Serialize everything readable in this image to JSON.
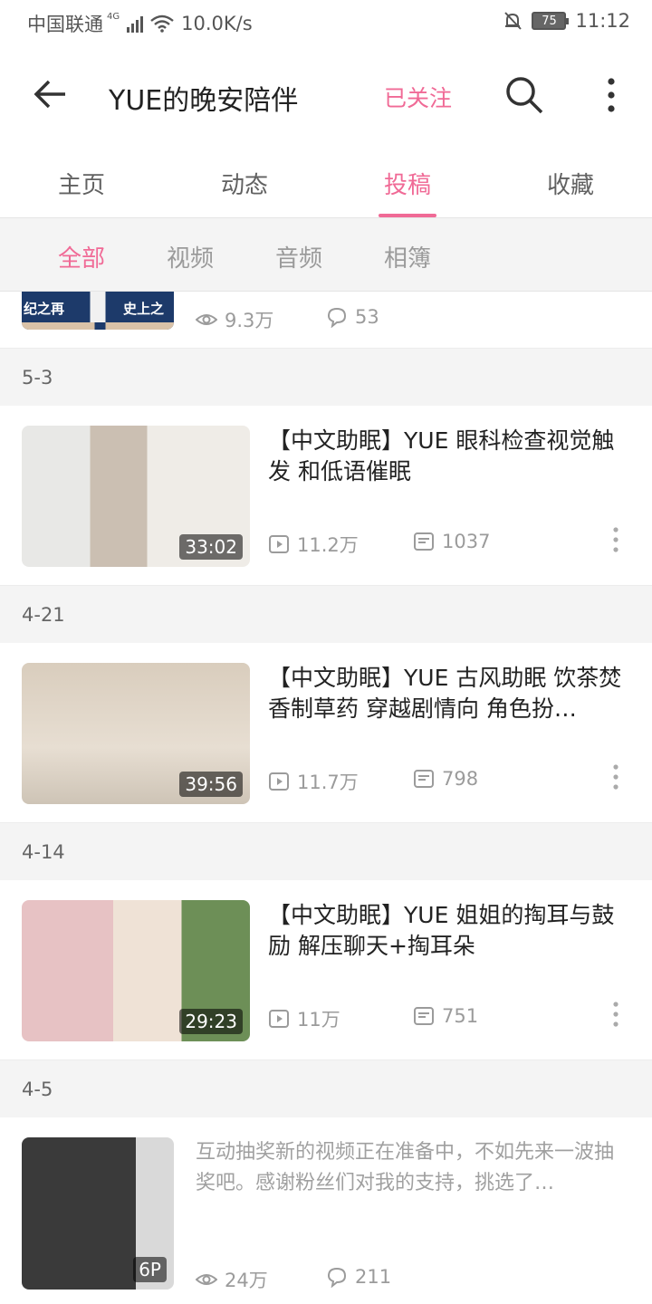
{
  "status_bar": {
    "carrier": "中国联通",
    "network": "4G",
    "speed": "10.0K/s",
    "battery": "75",
    "time": "11:12"
  },
  "header": {
    "title": "YUE的晚安陪伴",
    "follow_label": "已关注"
  },
  "tabs": [
    {
      "label": "主页"
    },
    {
      "label": "动态"
    },
    {
      "label": "投稿"
    },
    {
      "label": "收藏"
    }
  ],
  "active_tab": "投稿",
  "filters": [
    {
      "label": "全部"
    },
    {
      "label": "视频"
    },
    {
      "label": "音频"
    },
    {
      "label": "相簿"
    }
  ],
  "active_filter": "全部",
  "partial_item": {
    "thumb_text_left": "纪之再",
    "thumb_text_right": "史上之",
    "views": "9.3万",
    "comments": "53"
  },
  "groups": [
    {
      "date": "5-3",
      "title": "【中文助眠】YUE 眼科检查视觉触发 和低语催眠",
      "duration": "33:02",
      "plays": "11.2万",
      "danmaku": "1037"
    },
    {
      "date": "4-21",
      "title": "【中文助眠】YUE 古风助眠 饮茶焚香制草药 穿越剧情向 角色扮…",
      "duration": "39:56",
      "plays": "11.7万",
      "danmaku": "798"
    },
    {
      "date": "4-14",
      "title": "【中文助眠】YUE 姐姐的掏耳与鼓励 解压聊天+掏耳朵",
      "duration": "29:23",
      "plays": "11万",
      "danmaku": "751"
    }
  ],
  "album": {
    "date": "4-5",
    "desc": "互动抽奖新的视频正在准备中，不如先来一波抽奖吧。感谢粉丝们对我的支持，挑选了…",
    "count_badge": "6P",
    "views": "24万",
    "comments": "211"
  },
  "colors": {
    "accent": "#f06a96",
    "muted": "#9b9b9b",
    "band": "#f4f4f4"
  }
}
